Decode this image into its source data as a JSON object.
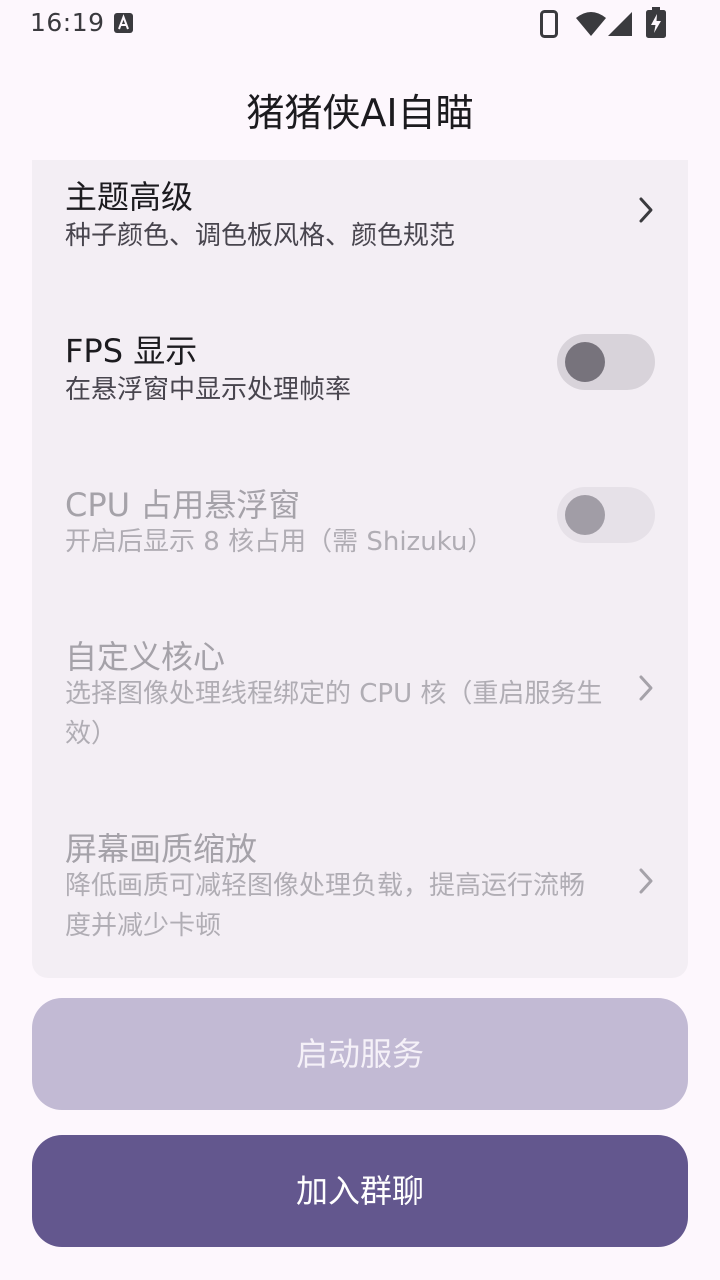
{
  "status_bar": {
    "time": "16:19"
  },
  "app": {
    "title": "猪猪侠AI自瞄"
  },
  "settings": [
    {
      "title": "主题高级",
      "desc": "种子颜色、调色板风格、颜色规范",
      "control": "chevron",
      "enabled": true
    },
    {
      "title": "FPS 显示",
      "desc": "在悬浮窗中显示处理帧率",
      "control": "toggle",
      "on": false,
      "enabled": true
    },
    {
      "title": "CPU 占用悬浮窗",
      "desc": "开启后显示 8 核占用（需 Shizuku）",
      "control": "toggle",
      "on": false,
      "enabled": false
    },
    {
      "title": "自定义核心",
      "desc": "选择图像处理线程绑定的 CPU 核（重启服务生效）",
      "control": "chevron",
      "enabled": false
    },
    {
      "title": "屏幕画质缩放",
      "desc": "降低画质可减轻图像处理负载，提高运行流畅度并减少卡顿",
      "control": "chevron",
      "enabled": false
    }
  ],
  "buttons": {
    "start_service": "启动服务",
    "join_group": "加入群聊"
  },
  "colors": {
    "background": "#fdf7fd",
    "card": "#f3eef4",
    "primary": "#63578e",
    "primary_disabled": "#c2bad4"
  }
}
